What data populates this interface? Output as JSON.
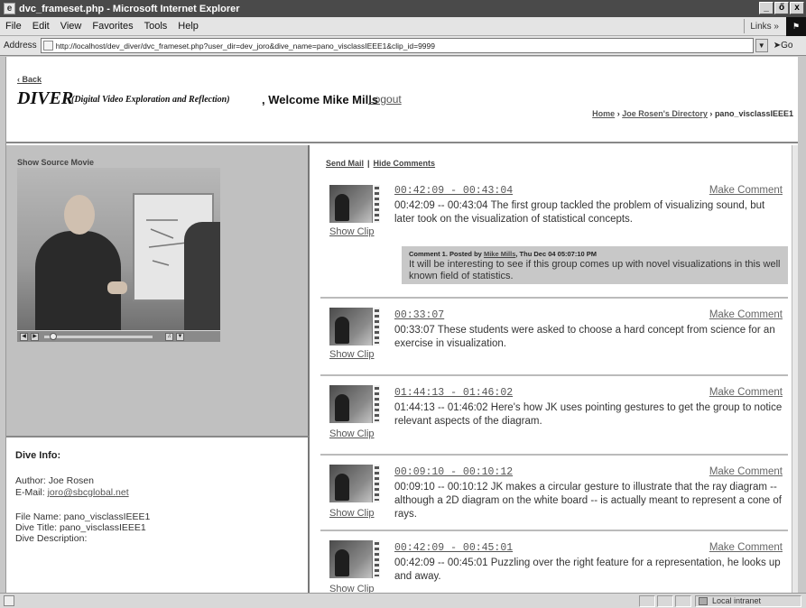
{
  "window": {
    "title": "dvc_frameset.php - Microsoft Internet Explorer",
    "minimize": "_",
    "maximize": "ő",
    "close": "x"
  },
  "menu": {
    "items": [
      "File",
      "Edit",
      "View",
      "Favorites",
      "Tools",
      "Help"
    ],
    "links_label": "Links »"
  },
  "address": {
    "label": "Address",
    "url": "http://localhost/dev_diver/dvc_frameset.php?user_dir=dev_joro&dive_name=pano_visclassIEEE1&clip_id=9999",
    "go_label": "Go"
  },
  "header": {
    "back": "‹ Back",
    "title": "DIVER",
    "subtitle": "(Digital Video Exploration and Reflection)",
    "welcome": ", Welcome Mike Mills",
    "logout": "Logout",
    "breadcrumb": {
      "home": "Home",
      "sep": "›",
      "directory": "Joe Rosen's Directory",
      "current": "pano_visclassIEEE1"
    }
  },
  "left": {
    "show_source": "Show Source Movie",
    "dive_info_title": "Dive Info:",
    "author": "Author: Joe Rosen",
    "email_label": "E-Mail:",
    "email": "joro@sbcglobal.net",
    "file_name": "File Name: pano_visclassIEEE1",
    "dive_title": "Dive Title: pano_visclassIEEE1",
    "dive_description": "Dive Description:"
  },
  "right": {
    "send_mail": "Send Mail",
    "separator": "|",
    "hide_comments": "Hide Comments",
    "show_clip": "Show Clip",
    "make_comment": "Make Comment",
    "clips": [
      {
        "timecode": "00:42:09 - 00:43:04",
        "desc": "00:42:09 -- 00:43:04 The first group tackled the problem of visualizing sound, but later took on the visualization of statistical concepts."
      },
      {
        "timecode": "00:33:07",
        "desc": "00:33:07 These students were asked to choose a hard concept from science for an exercise in visualization."
      },
      {
        "timecode": "01:44:13 - 01:46:02",
        "desc": "01:44:13 -- 01:46:02 Here's how JK uses pointing gestures to get the group to notice relevant aspects of the diagram."
      },
      {
        "timecode": "00:09:10 - 00:10:12",
        "desc": "00:09:10 -- 00:10:12 JK makes a circular gesture to illustrate that the ray diagram -- although a 2D diagram on the white board -- is actually meant to represent a cone of rays."
      },
      {
        "timecode": "00:42:09 - 00:45:01",
        "desc": "00:42:09 -- 00:45:01 Puzzling over the right feature for a representation, he looks up and away."
      }
    ],
    "comment": {
      "prefix": "Comment 1. Posted by",
      "author": "Mike Mills",
      "date": ", Thu Dec 04 05:07:10 PM",
      "text": "It will be interesting to see if this group comes up with novel visualizations in this well known field of statistics."
    }
  },
  "status": {
    "zone": "Local intranet"
  }
}
